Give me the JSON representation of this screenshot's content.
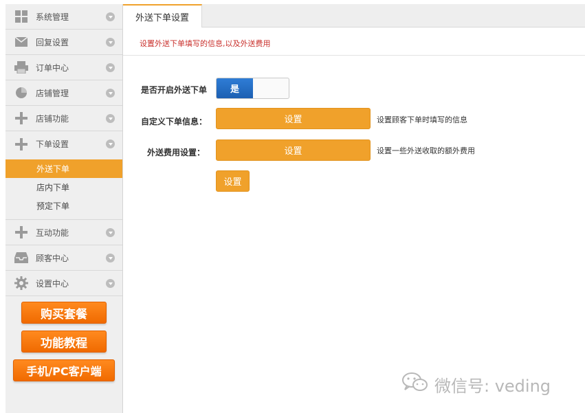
{
  "sidebar": {
    "items": [
      {
        "label": "系统管理",
        "icon": "grid-icon"
      },
      {
        "label": "回复设置",
        "icon": "mail-icon"
      },
      {
        "label": "订单中心",
        "icon": "printer-icon"
      },
      {
        "label": "店铺管理",
        "icon": "pie-chart-icon"
      },
      {
        "label": "店铺功能",
        "icon": "plus-icon"
      },
      {
        "label": "下单设置",
        "icon": "plus-icon"
      },
      {
        "label": "互动功能",
        "icon": "plus-icon"
      },
      {
        "label": "顾客中心",
        "icon": "inbox-icon"
      },
      {
        "label": "设置中心",
        "icon": "gear-icon"
      }
    ],
    "sub_items": [
      {
        "label": "外送下单",
        "active": true
      },
      {
        "label": "店内下单",
        "active": false
      },
      {
        "label": "预定下单",
        "active": false
      }
    ],
    "promo_buttons": {
      "buy": "购买套餐",
      "tutorial": "功能教程",
      "client": "手机/PC客户端"
    }
  },
  "main": {
    "tab_label": "外送下单设置",
    "hint": "设置外送下单填写的信息,以及外送费用",
    "enable_label": "是否开启外送下单",
    "toggle_on_label": "是",
    "custom_info_label": "自定义下单信息：",
    "custom_info_button": "设置",
    "custom_info_desc": "设置顾客下单时填写的信息",
    "fee_label": "外送费用设置：",
    "fee_button": "设置",
    "fee_desc": "设置一些外送收取的额外费用",
    "extra_button": "设置"
  },
  "watermark": {
    "text": "微信号: veding",
    "icon": "wechat-icon"
  },
  "colors": {
    "accent": "#f0a12b",
    "toggle_blue": "#1c5fb2",
    "hint_red": "#c9302c",
    "promo_orange": "#f47a10"
  }
}
